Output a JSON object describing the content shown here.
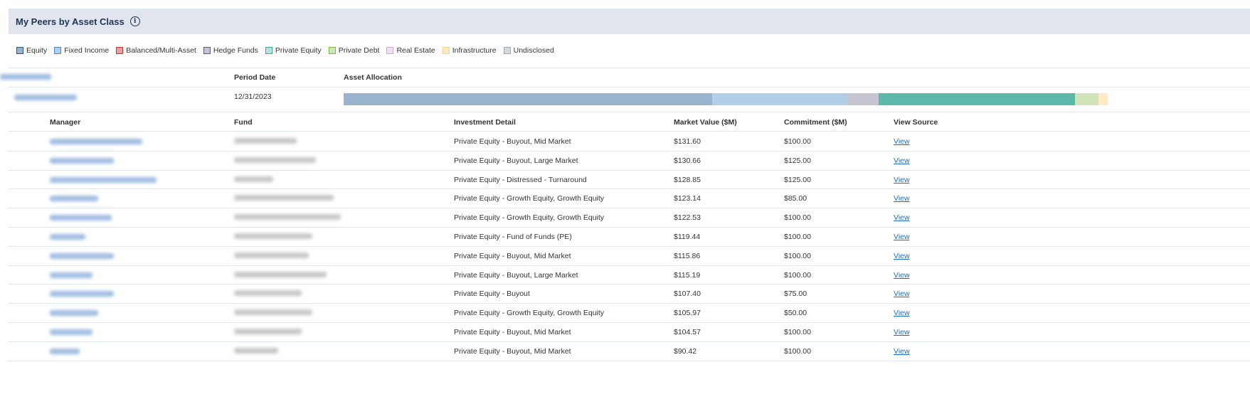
{
  "header": {
    "title": "My Peers by Asset Class",
    "info_icon": "info-circle-icon"
  },
  "legend": [
    {
      "label": "Equity",
      "fill": "#9ab3cc",
      "border": "#2b5783"
    },
    {
      "label": "Fixed Income",
      "fill": "#b3cfe8",
      "border": "#4a8ac4"
    },
    {
      "label": "Balanced/Multi-Asset",
      "fill": "#e8a0a4",
      "border": "#c0392b"
    },
    {
      "label": "Hedge Funds",
      "fill": "#c6c3d3",
      "border": "#5e5a7a"
    },
    {
      "label": "Private Equity",
      "fill": "#b9e2dc",
      "border": "#3fa89a"
    },
    {
      "label": "Private Debt",
      "fill": "#cfe4b8",
      "border": "#7ab648"
    },
    {
      "label": "Real Estate",
      "fill": "#ede0f1",
      "border": "#c8a9d6"
    },
    {
      "label": "Infrastructure",
      "fill": "#fcebc4",
      "border": "#f5d690"
    },
    {
      "label": "Undisclosed",
      "fill": "#d5d9de",
      "border": "#9ea6ae"
    }
  ],
  "investor_table": {
    "columns": [
      "Investor (redacted)",
      "Period Date",
      "Asset Allocation"
    ],
    "row": {
      "investor": "(redacted)",
      "period_date": "12/31/2023",
      "allocation_pct": [
        {
          "class": "Equity",
          "pct": 48.2,
          "color": "#9ab3cc"
        },
        {
          "class": "Fixed Income",
          "pct": 17.7,
          "color": "#b3cfe8"
        },
        {
          "class": "Hedge Funds",
          "pct": 4.1,
          "color": "#c6c3d3"
        },
        {
          "class": "Private Equity",
          "pct": 25.7,
          "color": "#5db8ac"
        },
        {
          "class": "Private Debt",
          "pct": 3.1,
          "color": "#cfe4b8"
        },
        {
          "class": "Infrastructure",
          "pct": 1.2,
          "color": "#fcebc4"
        }
      ]
    }
  },
  "holdings_table": {
    "columns": {
      "manager": "Manager",
      "fund": "Fund",
      "detail": "Investment Detail",
      "market_value": "Market Value ($M)",
      "commitment": "Commitment ($M)",
      "view_source": "View Source"
    },
    "rows": [
      {
        "manager": "(redacted)",
        "fund": "(redacted)",
        "detail": "Private Equity - Buyout, Mid Market",
        "market_value": "$131.60",
        "commitment": "$100.00",
        "view": "View"
      },
      {
        "manager": "(redacted)",
        "fund": "(redacted)",
        "detail": "Private Equity - Buyout, Large Market",
        "market_value": "$130.66",
        "commitment": "$125.00",
        "view": "View"
      },
      {
        "manager": "(redacted)",
        "fund": "(redacted)",
        "detail": "Private Equity - Distressed - Turnaround",
        "market_value": "$128.85",
        "commitment": "$125.00",
        "view": "View"
      },
      {
        "manager": "(redacted)",
        "fund": "(redacted)",
        "detail": "Private Equity - Growth Equity, Growth Equity",
        "market_value": "$123.14",
        "commitment": "$85.00",
        "view": "View"
      },
      {
        "manager": "(redacted)",
        "fund": "(redacted)",
        "detail": "Private Equity - Growth Equity, Growth Equity",
        "market_value": "$122.53",
        "commitment": "$100.00",
        "view": "View"
      },
      {
        "manager": "(redacted)",
        "fund": "(redacted)",
        "detail": "Private Equity - Fund of Funds (PE)",
        "market_value": "$119.44",
        "commitment": "$100.00",
        "view": "View"
      },
      {
        "manager": "(redacted)",
        "fund": "(redacted)",
        "detail": "Private Equity - Buyout, Mid Market",
        "market_value": "$115.86",
        "commitment": "$100.00",
        "view": "View"
      },
      {
        "manager": "(redacted)",
        "fund": "(redacted)",
        "detail": "Private Equity - Buyout, Large Market",
        "market_value": "$115.19",
        "commitment": "$100.00",
        "view": "View"
      },
      {
        "manager": "(redacted)",
        "fund": "(redacted)",
        "detail": "Private Equity - Buyout",
        "market_value": "$107.40",
        "commitment": "$75.00",
        "view": "View"
      },
      {
        "manager": "(redacted)",
        "fund": "(redacted)",
        "detail": "Private Equity - Growth Equity, Growth Equity",
        "market_value": "$105.97",
        "commitment": "$50.00",
        "view": "View"
      },
      {
        "manager": "(redacted)",
        "fund": "(redacted)",
        "detail": "Private Equity - Buyout, Mid Market",
        "market_value": "$104.57",
        "commitment": "$100.00",
        "view": "View"
      },
      {
        "manager": "(redacted)",
        "fund": "(redacted)",
        "detail": "Private Equity - Buyout, Mid Market",
        "market_value": "$90.42",
        "commitment": "$100.00",
        "view": "View"
      }
    ]
  }
}
